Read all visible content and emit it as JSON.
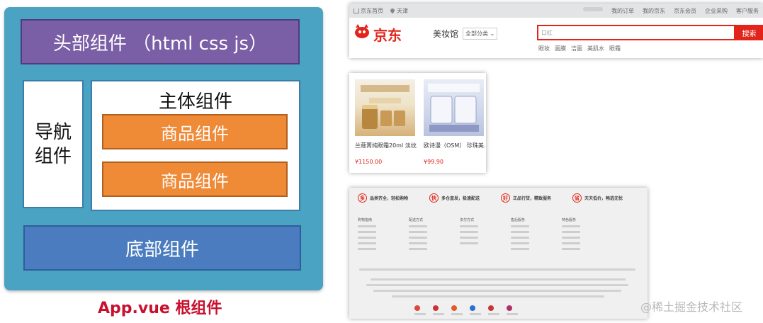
{
  "diagram": {
    "header": "头部组件 （html css js）",
    "nav_line1": "导航",
    "nav_line2": "组件",
    "main_title": "主体组件",
    "product1": "商品组件",
    "product2": "商品组件",
    "footer": "底部组件",
    "root_caption": "App.vue 根组件"
  },
  "jd_header": {
    "home_link": "京东首页",
    "location": "天津",
    "top_links": [
      "我的订单",
      "我的京东",
      "京东会员",
      "企业采购",
      "客户服务"
    ],
    "logo_text": "京东",
    "channel": "美妆馆",
    "category_select": "全部分类",
    "search_placeholder": "口红",
    "search_button": "搜索",
    "hot_words": [
      "眼妆",
      "面膜",
      "洁面",
      "美肌水",
      "眼霜"
    ]
  },
  "products": [
    {
      "name": "兰蔻菁纯眼霜20ml 淡纹...",
      "price": "¥1150.00"
    },
    {
      "name": "欧诗漫（OSM） 珍珠美...",
      "price": "¥99.90"
    }
  ],
  "jd_footer": {
    "services": [
      "品类齐全，轻松购物",
      "多仓直发，极速配送",
      "正品行货，精致服务",
      "天天低价，畅选无忧"
    ],
    "service_icons": [
      "多",
      "快",
      "好",
      "省"
    ],
    "columns": [
      "购物指南",
      "配送方式",
      "支付方式",
      "售后服务",
      "特色服务"
    ]
  },
  "watermark": "@稀土掘金技术社区",
  "colors": {
    "frame": "#4aa3c2",
    "header": "#7a5ea6",
    "product": "#ef8a37",
    "footer": "#4a7cbf",
    "jd_red": "#e1251b"
  }
}
